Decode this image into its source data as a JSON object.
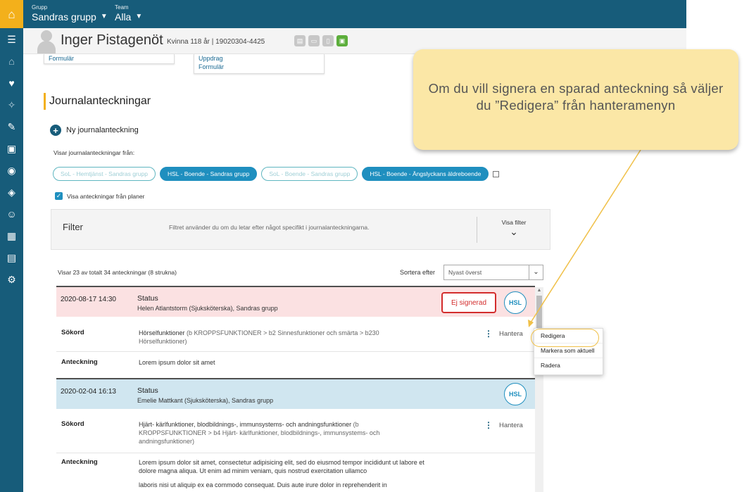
{
  "topbar": {
    "group_label": "Grupp",
    "group_value": "Sandras grupp",
    "team_label": "Team",
    "team_value": "Alla",
    "logo_icon": "house-logo-icon"
  },
  "sidebar": {
    "icons": [
      "menu-icon",
      "home-icon",
      "heart-icon",
      "puzzle-icon",
      "pen-icon",
      "calendar-user-icon",
      "target-icon",
      "shield-heart-icon",
      "person-circle-icon",
      "calendar-grid-icon",
      "document-list-icon",
      "gear-icon"
    ]
  },
  "patient": {
    "name": "Inger Pistagenöt",
    "info": "Kvinna 118 år  |  19020304-4425",
    "icons": [
      "plan-icon",
      "doc-icon",
      "note-icon",
      "bus-icon"
    ]
  },
  "cards": {
    "card1_link": "Formulär",
    "card2_link1": "Uppdrag",
    "card2_link2": "Formulär"
  },
  "journal": {
    "section_title": "Journalanteckningar",
    "new_label": "Ny journalanteckning",
    "show_from_label": "Visar journalanteckningar från:",
    "pills": [
      {
        "label": "SoL - Hemtjänst - Sandras grupp",
        "active": false
      },
      {
        "label": "HSL - Boende - Sandras grupp",
        "active": true
      },
      {
        "label": "SoL - Boende - Sandras grupp",
        "active": false
      },
      {
        "label": "HSL - Boende - Ängslyckans äldreboende",
        "active": true
      }
    ],
    "show_plans_label": "Visa anteckningar från planer"
  },
  "filter": {
    "title": "Filter",
    "description": "Filtret använder du om du letar efter något specifikt i journalanteckningarna.",
    "button_label": "Visa filter"
  },
  "list": {
    "count_text": "Visar 23 av totalt 34 anteckningar (8 strukna)",
    "sort_label": "Sortera efter",
    "sort_value": "Nyast överst"
  },
  "entries": [
    {
      "date": "2020-08-17  14:30",
      "title": "Status",
      "author": "Helen Atlantstorm (Sjuksköterska), Sandras grupp",
      "badge": "Ej signerad",
      "type": "HSL",
      "keyword_label": "Sökord",
      "keyword_main": "Hörselfunktioner",
      "keyword_path": " (b KROPPSFUNKTIONER > b2 Sinnesfunktioner och smärta > b230 Hörselfunktioner)",
      "note_label": "Anteckning",
      "note_text": "Lorem ipsum dolor sit amet",
      "action": "Hantera"
    },
    {
      "date": "2020-02-04  16:13",
      "title": "Status",
      "author": "Emelie Mattkant (Sjuksköterska), Sandras grupp",
      "type": "HSL",
      "keyword_label": "Sökord",
      "keyword_main": "Hjärt- kärlfunktioner, blodbildnings-, immunsystems- och andningsfunktioner",
      "keyword_path": " (b KROPPSFUNKTIONER > b4 Hjärt- kärlfunktioner, blodbildnings-, immunsystems- och andningsfunktioner)",
      "note_label": "Anteckning",
      "note_text": "Lorem ipsum dolor sit amet, consectetur adipisicing elit, sed do eiusmod tempor incididunt ut labore et dolore magna aliqua. Ut enim ad minim veniam, quis nostrud exercitation ullamco",
      "note_cut": "laboris nisi ut aliquip ex ea commodo consequat. Duis aute irure dolor in reprehenderit in",
      "action": "Hantera"
    }
  ],
  "menu": {
    "items": [
      "Redigera",
      "Markera som aktuell",
      "Radera"
    ]
  },
  "callout": {
    "text": "Om du vill signera en sparad anteckning så väljer du ”Redigera” från hanteramenyn"
  },
  "colors": {
    "brand": "#175c7a",
    "accent": "#f3b01b",
    "pill_active": "#1f8fbf",
    "unsigned_red": "#d32c2c",
    "callout_bg": "#fbe7a6"
  }
}
